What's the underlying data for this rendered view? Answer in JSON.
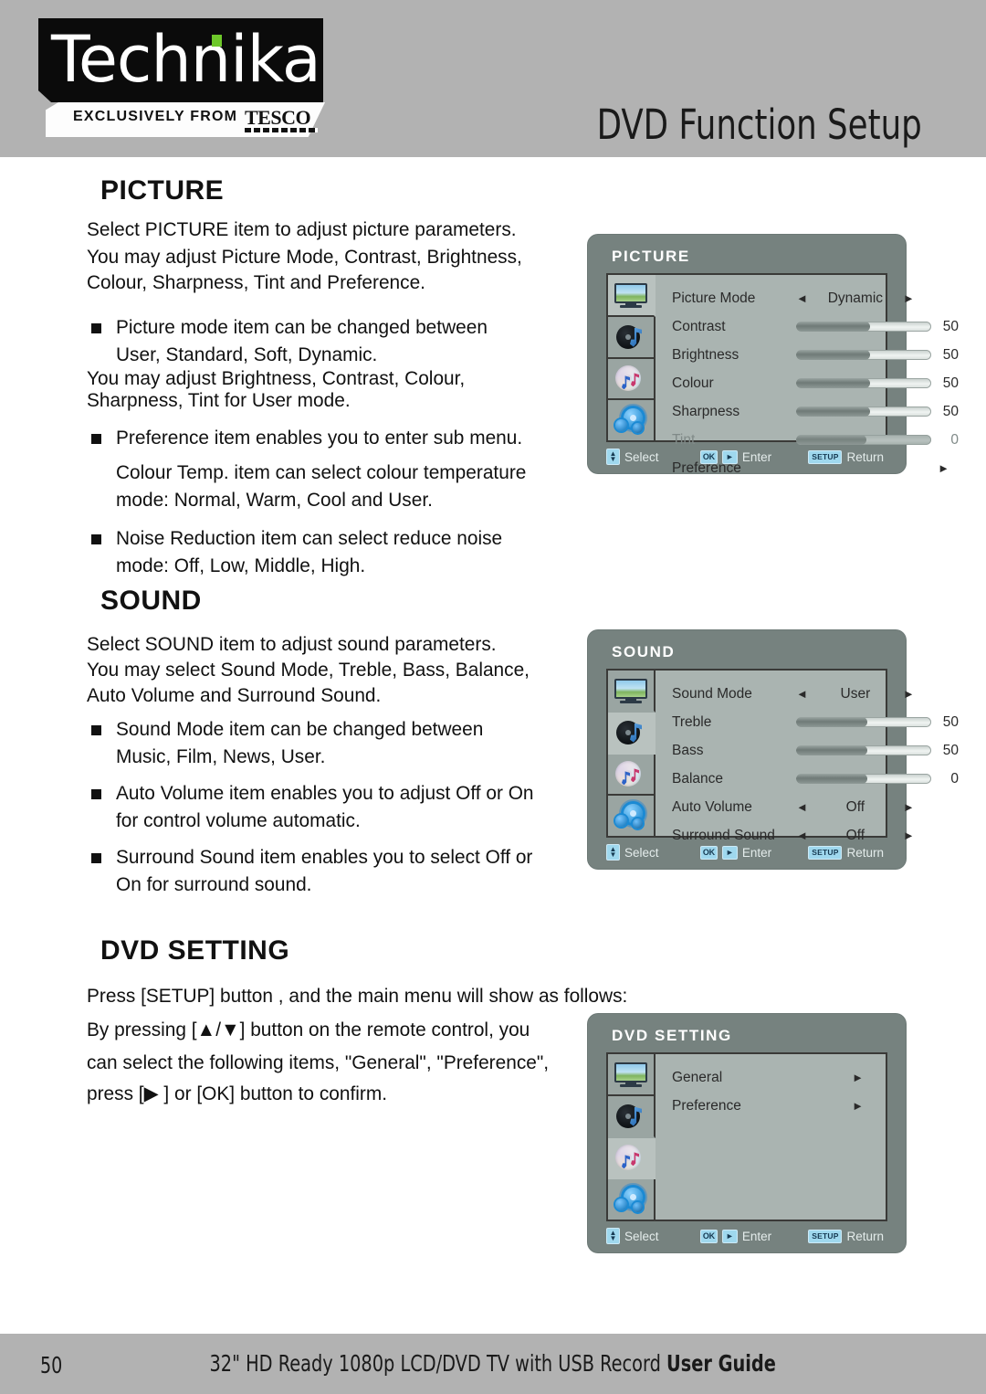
{
  "header": {
    "logo_text": "Technika",
    "logo_exclusive": "EXCLUSIVELY FROM",
    "logo_brand": "TESCO",
    "title": "DVD Function Setup"
  },
  "sections": {
    "picture": {
      "heading": "PICTURE",
      "intro": [
        "Select  PICTURE item to adjust picture parameters.",
        "You may adjust Picture Mode, Contrast, Brightness,",
        "Colour, Sharpness, Tint and Preference."
      ],
      "bullets": [
        {
          "lines": [
            "Picture mode item can be changed between",
            "User, Standard, Soft, Dynamic."
          ]
        }
      ],
      "para2": [
        "You may adjust Brightness, Contrast, Colour,",
        "Sharpness, Tint for User mode."
      ],
      "bullets2": [
        {
          "lines": [
            "Preference item enables you to enter sub menu."
          ]
        },
        {
          "plain": [
            "Colour Temp. item can select colour temperature",
            "mode: Normal, Warm, Cool and User."
          ]
        },
        {
          "lines": [
            "Noise Reduction item can select reduce noise",
            "mode: Off, Low, Middle, High."
          ]
        }
      ]
    },
    "sound": {
      "heading": "SOUND",
      "intro": [
        "Select SOUND item to adjust sound parameters.",
        "You may select Sound Mode, Treble, Bass, Balance,",
        "Auto Volume and Surround Sound."
      ],
      "bullets": [
        {
          "lines": [
            "Sound Mode item can be changed between",
            "Music, Film, News, User."
          ]
        },
        {
          "lines": [
            "Auto Volume item enables you to adjust Off  or On",
            "for control volume automatic."
          ]
        },
        {
          "lines": [
            "Surround Sound item enables you to select Off or",
            "On for surround sound."
          ]
        }
      ]
    },
    "dvd_setting": {
      "heading": "DVD SETTING",
      "lines": [
        "Press [SETUP] button , and the main menu will show as follows:",
        "By pressing [▲/▼] button on the remote control, you",
        "can select the following items, \"General\", \"Preference\",",
        "press [▶ ] or [OK]  button to confirm."
      ]
    }
  },
  "osd_picture": {
    "title": "PICTURE",
    "icons": [
      "tv-icon",
      "disc-icon",
      "music-disc-icon",
      "gear-icon"
    ],
    "selected_icon_index": 0,
    "rows": [
      {
        "label": "Picture Mode",
        "type": "option",
        "value": "Dynamic",
        "left_arrow": "◄",
        "right_arrow": "►"
      },
      {
        "label": "Contrast",
        "type": "slider",
        "value": "50",
        "fill_percent": 55
      },
      {
        "label": "Brightness",
        "type": "slider",
        "value": "50",
        "fill_percent": 55
      },
      {
        "label": "Colour",
        "type": "slider",
        "value": "50",
        "fill_percent": 55
      },
      {
        "label": "Sharpness",
        "type": "slider",
        "value": "50",
        "fill_percent": 55
      },
      {
        "label": "Tint",
        "type": "slider",
        "value": "0",
        "fill_percent": 52,
        "dim": true
      },
      {
        "label": "Preference",
        "type": "submenu",
        "value": "",
        "right_arrow": "►"
      }
    ],
    "footer": {
      "select_key": "▲▼",
      "select_label": "Select",
      "ok_key": "OK",
      "play_key": "►",
      "enter_label": "Enter",
      "setup_key": "SETUP",
      "return_label": "Return"
    }
  },
  "osd_sound": {
    "title": "SOUND",
    "icons": [
      "tv-icon",
      "disc-icon",
      "music-disc-icon",
      "gear-icon"
    ],
    "selected_icon_index": 1,
    "rows": [
      {
        "label": "Sound Mode",
        "type": "option",
        "value": "User",
        "left_arrow": "◄",
        "right_arrow": "►"
      },
      {
        "label": "Treble",
        "type": "slider",
        "value": "50",
        "fill_percent": 53
      },
      {
        "label": "Bass",
        "type": "slider",
        "value": "50",
        "fill_percent": 53
      },
      {
        "label": "Balance",
        "type": "slider",
        "value": "0",
        "fill_percent": 53
      },
      {
        "label": "Auto Volume",
        "type": "option",
        "value": "Off",
        "left_arrow": "◄",
        "right_arrow": "►"
      },
      {
        "label": "Surround Sound",
        "type": "option",
        "value": "Off",
        "left_arrow": "◄",
        "right_arrow": "►"
      }
    ],
    "footer": {
      "select_key": "▲▼",
      "select_label": "Select",
      "ok_key": "OK",
      "play_key": "►",
      "enter_label": "Enter",
      "setup_key": "SETUP",
      "return_label": "Return"
    }
  },
  "osd_dvd": {
    "title": "DVD SETTING",
    "icons": [
      "tv-icon",
      "disc-icon",
      "music-disc-icon",
      "gear-icon"
    ],
    "selected_icon_index": 2,
    "rows": [
      {
        "label": "General",
        "type": "submenu",
        "right_arrow": "►"
      },
      {
        "label": "Preference",
        "type": "submenu",
        "right_arrow": "►"
      }
    ],
    "footer": {
      "select_key": "▲▼",
      "select_label": "Select",
      "ok_key": "OK",
      "play_key": "►",
      "enter_label": "Enter",
      "setup_key": "SETUP",
      "return_label": "Return"
    }
  },
  "footer": {
    "page_number": "50",
    "product": "32\" HD Ready 1080p LCD/DVD TV with USB Record",
    "guide": "User Guide"
  }
}
